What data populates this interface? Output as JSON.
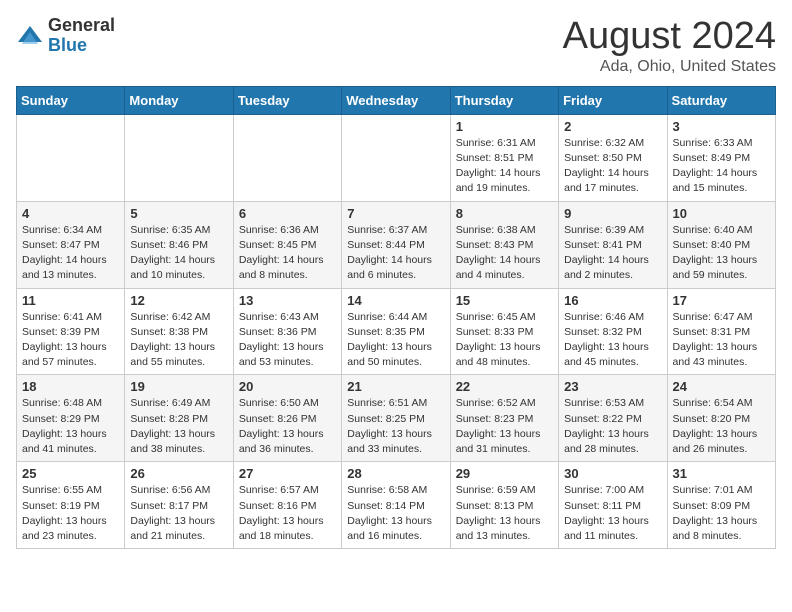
{
  "header": {
    "logo_general": "General",
    "logo_blue": "Blue",
    "title": "August 2024",
    "location": "Ada, Ohio, United States"
  },
  "days_of_week": [
    "Sunday",
    "Monday",
    "Tuesday",
    "Wednesday",
    "Thursday",
    "Friday",
    "Saturday"
  ],
  "weeks": [
    [
      {
        "day": "",
        "info": ""
      },
      {
        "day": "",
        "info": ""
      },
      {
        "day": "",
        "info": ""
      },
      {
        "day": "",
        "info": ""
      },
      {
        "day": "1",
        "info": "Sunrise: 6:31 AM\nSunset: 8:51 PM\nDaylight: 14 hours\nand 19 minutes."
      },
      {
        "day": "2",
        "info": "Sunrise: 6:32 AM\nSunset: 8:50 PM\nDaylight: 14 hours\nand 17 minutes."
      },
      {
        "day": "3",
        "info": "Sunrise: 6:33 AM\nSunset: 8:49 PM\nDaylight: 14 hours\nand 15 minutes."
      }
    ],
    [
      {
        "day": "4",
        "info": "Sunrise: 6:34 AM\nSunset: 8:47 PM\nDaylight: 14 hours\nand 13 minutes."
      },
      {
        "day": "5",
        "info": "Sunrise: 6:35 AM\nSunset: 8:46 PM\nDaylight: 14 hours\nand 10 minutes."
      },
      {
        "day": "6",
        "info": "Sunrise: 6:36 AM\nSunset: 8:45 PM\nDaylight: 14 hours\nand 8 minutes."
      },
      {
        "day": "7",
        "info": "Sunrise: 6:37 AM\nSunset: 8:44 PM\nDaylight: 14 hours\nand 6 minutes."
      },
      {
        "day": "8",
        "info": "Sunrise: 6:38 AM\nSunset: 8:43 PM\nDaylight: 14 hours\nand 4 minutes."
      },
      {
        "day": "9",
        "info": "Sunrise: 6:39 AM\nSunset: 8:41 PM\nDaylight: 14 hours\nand 2 minutes."
      },
      {
        "day": "10",
        "info": "Sunrise: 6:40 AM\nSunset: 8:40 PM\nDaylight: 13 hours\nand 59 minutes."
      }
    ],
    [
      {
        "day": "11",
        "info": "Sunrise: 6:41 AM\nSunset: 8:39 PM\nDaylight: 13 hours\nand 57 minutes."
      },
      {
        "day": "12",
        "info": "Sunrise: 6:42 AM\nSunset: 8:38 PM\nDaylight: 13 hours\nand 55 minutes."
      },
      {
        "day": "13",
        "info": "Sunrise: 6:43 AM\nSunset: 8:36 PM\nDaylight: 13 hours\nand 53 minutes."
      },
      {
        "day": "14",
        "info": "Sunrise: 6:44 AM\nSunset: 8:35 PM\nDaylight: 13 hours\nand 50 minutes."
      },
      {
        "day": "15",
        "info": "Sunrise: 6:45 AM\nSunset: 8:33 PM\nDaylight: 13 hours\nand 48 minutes."
      },
      {
        "day": "16",
        "info": "Sunrise: 6:46 AM\nSunset: 8:32 PM\nDaylight: 13 hours\nand 45 minutes."
      },
      {
        "day": "17",
        "info": "Sunrise: 6:47 AM\nSunset: 8:31 PM\nDaylight: 13 hours\nand 43 minutes."
      }
    ],
    [
      {
        "day": "18",
        "info": "Sunrise: 6:48 AM\nSunset: 8:29 PM\nDaylight: 13 hours\nand 41 minutes."
      },
      {
        "day": "19",
        "info": "Sunrise: 6:49 AM\nSunset: 8:28 PM\nDaylight: 13 hours\nand 38 minutes."
      },
      {
        "day": "20",
        "info": "Sunrise: 6:50 AM\nSunset: 8:26 PM\nDaylight: 13 hours\nand 36 minutes."
      },
      {
        "day": "21",
        "info": "Sunrise: 6:51 AM\nSunset: 8:25 PM\nDaylight: 13 hours\nand 33 minutes."
      },
      {
        "day": "22",
        "info": "Sunrise: 6:52 AM\nSunset: 8:23 PM\nDaylight: 13 hours\nand 31 minutes."
      },
      {
        "day": "23",
        "info": "Sunrise: 6:53 AM\nSunset: 8:22 PM\nDaylight: 13 hours\nand 28 minutes."
      },
      {
        "day": "24",
        "info": "Sunrise: 6:54 AM\nSunset: 8:20 PM\nDaylight: 13 hours\nand 26 minutes."
      }
    ],
    [
      {
        "day": "25",
        "info": "Sunrise: 6:55 AM\nSunset: 8:19 PM\nDaylight: 13 hours\nand 23 minutes."
      },
      {
        "day": "26",
        "info": "Sunrise: 6:56 AM\nSunset: 8:17 PM\nDaylight: 13 hours\nand 21 minutes."
      },
      {
        "day": "27",
        "info": "Sunrise: 6:57 AM\nSunset: 8:16 PM\nDaylight: 13 hours\nand 18 minutes."
      },
      {
        "day": "28",
        "info": "Sunrise: 6:58 AM\nSunset: 8:14 PM\nDaylight: 13 hours\nand 16 minutes."
      },
      {
        "day": "29",
        "info": "Sunrise: 6:59 AM\nSunset: 8:13 PM\nDaylight: 13 hours\nand 13 minutes."
      },
      {
        "day": "30",
        "info": "Sunrise: 7:00 AM\nSunset: 8:11 PM\nDaylight: 13 hours\nand 11 minutes."
      },
      {
        "day": "31",
        "info": "Sunrise: 7:01 AM\nSunset: 8:09 PM\nDaylight: 13 hours\nand 8 minutes."
      }
    ]
  ]
}
